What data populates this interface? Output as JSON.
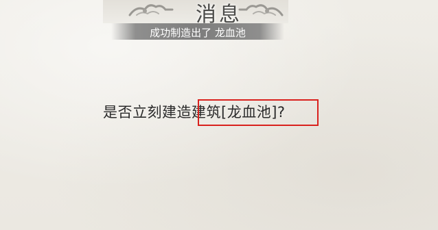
{
  "dialog": {
    "title": "消息",
    "subtitle": "成功制造出了 龙血池",
    "question": "是否立刻建造建筑[龙血池]?"
  },
  "annotation": {
    "highlight_color": "#d9201c"
  },
  "colors": {
    "background": "#efede8",
    "subtitle_bar": "#777777",
    "text": "#2a2a2a"
  }
}
